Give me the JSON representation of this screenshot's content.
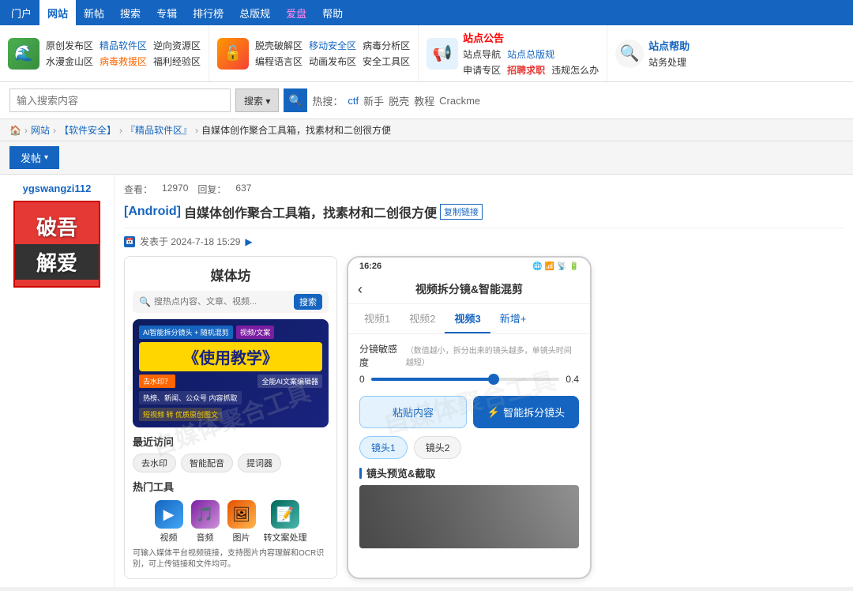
{
  "topnav": {
    "items": [
      {
        "label": "门户",
        "active": false
      },
      {
        "label": "网站",
        "active": true
      },
      {
        "label": "新帖",
        "active": false
      },
      {
        "label": "搜索",
        "active": false
      },
      {
        "label": "专辑",
        "active": false
      },
      {
        "label": "排行榜",
        "active": false
      },
      {
        "label": "总版规",
        "active": false
      },
      {
        "label": "爱盘",
        "active": false,
        "highlight": "pink"
      },
      {
        "label": "帮助",
        "active": false
      }
    ]
  },
  "banner": {
    "left": {
      "links_row1": [
        "原创发布区",
        "精品软件区",
        "逆向资源区"
      ],
      "links_row2": [
        "水漫金山区",
        "病毒救援区",
        "福利经验区"
      ]
    },
    "mid": {
      "links_row1": [
        "脱壳破解区",
        "移动安全区",
        "病毒分析区"
      ],
      "links_row2": [
        "编程语言区",
        "动画发布区",
        "安全工具区"
      ]
    },
    "right": {
      "title": "站点公告",
      "links_row1": [
        "站点导航",
        "站点总版规"
      ],
      "links_row2": [
        "申请专区",
        "招聘求职",
        "违规怎么办"
      ],
      "help_title": "站点帮助",
      "help_sub": "站务处理"
    }
  },
  "search": {
    "placeholder": "输入搜索内容",
    "btn_label": "搜索 ▾",
    "hot_label": "热搜：",
    "hot_tags": [
      "ctf",
      "新手",
      "脱壳",
      "教程",
      "Crackme"
    ]
  },
  "breadcrumb": {
    "home": "🏠",
    "items": [
      "网站",
      "【软件安全】",
      "『精品软件区』",
      "自媒体创作聚合工具箱，找素材和二创很方便"
    ]
  },
  "post_btn": "发帖",
  "thread": {
    "views_label": "查看：",
    "views": "12970",
    "replies_label": "回复：",
    "replies": "637",
    "title_tag": "[Android]",
    "title_main": "自媒体创作聚合工具箱，找素材和二创很方便",
    "copy_link": "复制链接",
    "author": "ygswangzi112",
    "date": "发表于 2024-7-18 15:29",
    "avatar_line1": "破吾",
    "avatar_line2": "解爱"
  },
  "app": {
    "name": "媒体坊",
    "search_placeholder": "搜热点内容、文章、视频...",
    "search_btn": "搜索",
    "banner": {
      "tag1": "AI智能拆分镜头 + 随机混剪",
      "tag2": "视频/文案",
      "tag3": "视频/文案",
      "main_title": "《使用教学》",
      "sub1": "去水印？",
      "sub2": "全能AI文案编辑器",
      "sub3": "热榜、新闻、公众号 内容抓取",
      "sub4": "短视频 转 优质原创图文"
    },
    "recent_title": "最近访问",
    "recent_chips": [
      "去水印",
      "智能配音",
      "提词器"
    ],
    "hot_title": "热门工具",
    "tools": [
      {
        "label": "视频",
        "icon": "▶"
      },
      {
        "label": "音频",
        "icon": "🎵"
      },
      {
        "label": "图片",
        "icon": "🖼"
      },
      {
        "label": "转文案处理",
        "icon": "📝"
      }
    ],
    "tool_desc": "可输入媒体平台视频链接，支持图片内容理解和OCR识别，可上传链接和文件均可。"
  },
  "phone": {
    "time": "16:26",
    "title": "视频拆分镜&智能混剪",
    "tabs": [
      "视频1",
      "视频2",
      "视频3",
      "新增+"
    ],
    "active_tab": "视频3",
    "slider_label": "分镜敏感度",
    "slider_hint": "（数值越小，拆分出来的镜头越多，单镜头时间越短）",
    "slider_min": "0",
    "slider_max": "0.4",
    "paste_btn": "粘贴内容",
    "smart_btn": "智能拆分镜头",
    "clips": [
      "镜头1",
      "镜头2"
    ],
    "active_clip": "镜头1",
    "preview_title": "镜头预览&截取"
  }
}
